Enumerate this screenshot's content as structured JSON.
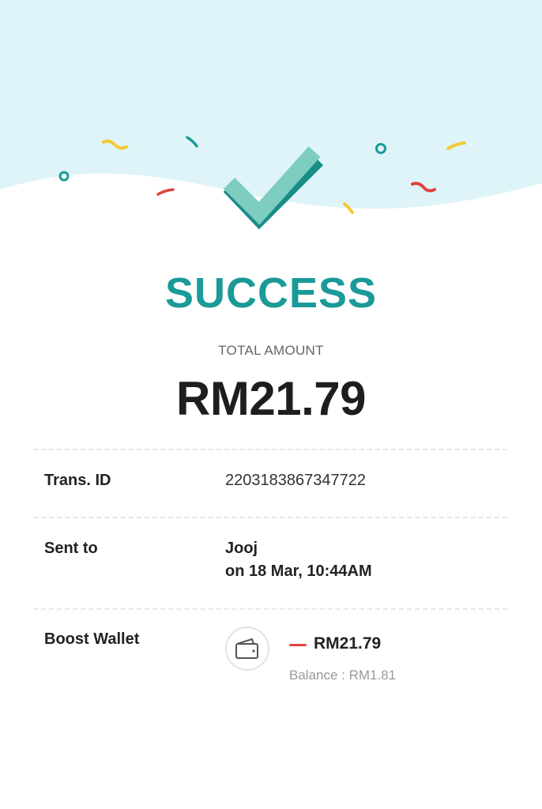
{
  "header": {
    "status": "SUCCESS",
    "total_label": "TOTAL AMOUNT",
    "total_amount": "RM21.79"
  },
  "details": {
    "trans_id_label": "Trans. ID",
    "trans_id_value": "2203183867347722",
    "sent_to_label": "Sent to",
    "sent_to_name": "Jooj",
    "sent_to_time": "on 18 Mar, 10:44AM",
    "wallet_label": "Boost Wallet",
    "wallet_debit": "RM21.79",
    "wallet_balance": "Balance : RM1.81"
  },
  "icons": {
    "success": "checkmark-icon",
    "wallet": "wallet-icon",
    "debit": "minus-icon"
  },
  "colors": {
    "accent": "#1a9a98",
    "check": "#7dcdc0",
    "hero_bg": "#dff4f8",
    "debit": "#e0443c",
    "confetti_yellow": "#f5c934",
    "confetti_red": "#e0443c",
    "confetti_teal": "#1a9a98"
  }
}
